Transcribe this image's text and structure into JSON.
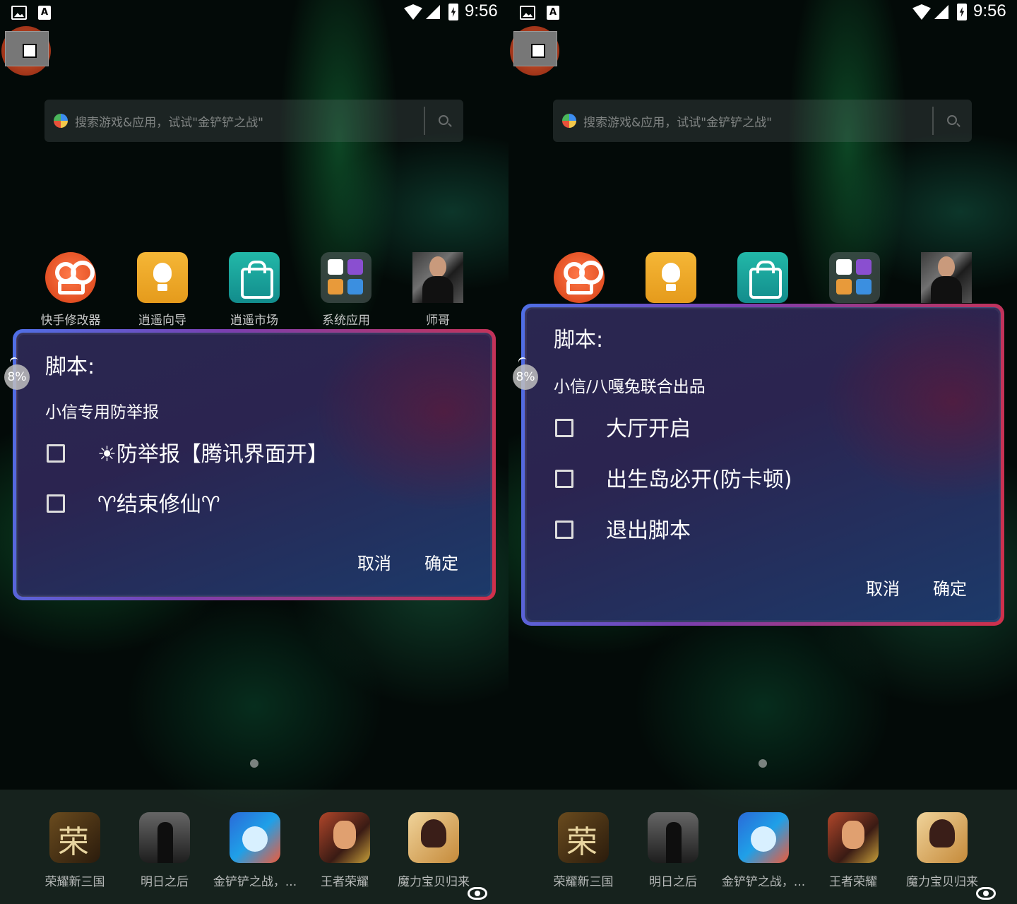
{
  "status_bar": {
    "time": "9:56"
  },
  "search": {
    "placeholder": "搜索游戏&应用，试试\"金铲铲之战\""
  },
  "apps": [
    {
      "label": "快手修改器",
      "icon": "kuaishou-icon"
    },
    {
      "label": "逍遥向导",
      "icon": "lightbulb-icon"
    },
    {
      "label": "逍遥市场",
      "icon": "market-bag-icon"
    },
    {
      "label": "系统应用",
      "icon": "folder-icon"
    },
    {
      "label": "师哥",
      "icon": "photo-icon"
    }
  ],
  "dock": [
    {
      "label": "荣耀新三国",
      "icon": "game-icon"
    },
    {
      "label": "明日之后",
      "icon": "game-icon"
    },
    {
      "label": "金铲铲之战，...",
      "icon": "game-icon"
    },
    {
      "label": "王者荣耀",
      "icon": "game-icon"
    },
    {
      "label": "魔力宝贝归来",
      "icon": "game-icon"
    }
  ],
  "progress_badge": "8%",
  "left_dialog": {
    "title": "脚本:",
    "message": "小信专用防举报",
    "options": [
      {
        "label": "☀防举报【腾讯界面开】",
        "checked": false
      },
      {
        "label": "♈结束修仙♈",
        "checked": false
      }
    ],
    "cancel": "取消",
    "confirm": "确定"
  },
  "right_dialog": {
    "title": "脚本:",
    "message": "小信/八嘎兔联合出品",
    "options": [
      {
        "label": "大厅开启",
        "checked": false
      },
      {
        "label": "出生岛必开(防卡顿)",
        "checked": false
      },
      {
        "label": "退出脚本",
        "checked": false
      }
    ],
    "cancel": "取消",
    "confirm": "确定"
  },
  "colors": {
    "dialog_border_start": "#4f6fe6",
    "dialog_border_end": "#d0304a",
    "dialog_bg": "#2a2750"
  }
}
